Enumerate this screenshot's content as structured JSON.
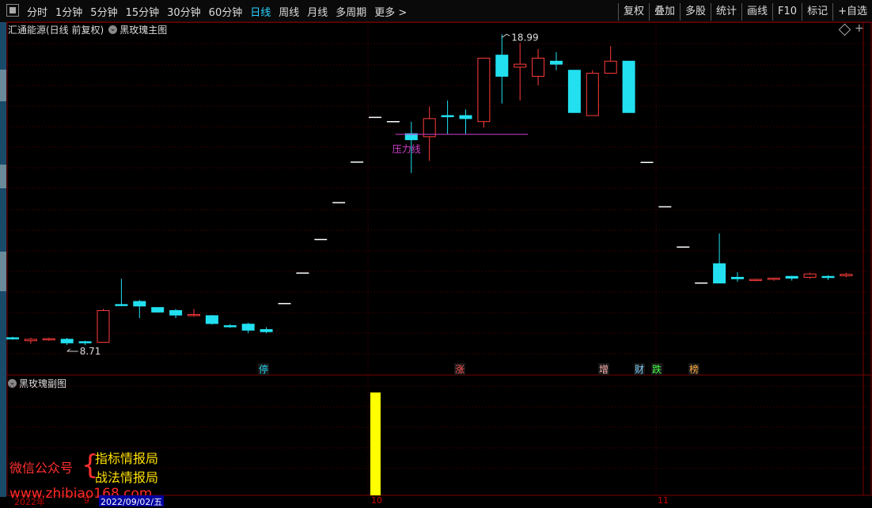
{
  "toolbar": {
    "left_items": [
      "分时",
      "1分钟",
      "5分钟",
      "15分钟",
      "30分钟",
      "60分钟",
      "日线",
      "周线",
      "月线",
      "多周期",
      "更多 >"
    ],
    "active": "日线",
    "right_items": [
      "复权",
      "叠加",
      "多股",
      "统计",
      "画线",
      "F10",
      "标记",
      "+自选"
    ]
  },
  "main_chart": {
    "stock_title": "汇通能源(日线 前复权)",
    "indicator_name": "黑玫瑰主图",
    "high_label": "18.99",
    "low_label": "8.71",
    "resistance_label": "压力线",
    "event_markers": [
      {
        "text": "停",
        "color": "#22d3ee"
      },
      {
        "text": "涨",
        "color": "#ff5555"
      },
      {
        "text": "增",
        "color": "#ffb0b0"
      },
      {
        "text": "财",
        "color": "#7fd0ff"
      },
      {
        "text": "跌",
        "color": "#44ff44"
      },
      {
        "text": "榜",
        "color": "#ffaa44"
      }
    ]
  },
  "sub_chart": {
    "indicator_name": "黑玫瑰副图"
  },
  "overlay": {
    "wechat_label": "微信公众号",
    "brand1": "指标情报局",
    "brand2": "战法情报局",
    "watermark": "www.zhibiao168.com"
  },
  "date_axis": {
    "labels": [
      "2022年",
      "9",
      "10",
      "11"
    ],
    "cursor_date": "2022/09/02/五"
  },
  "icons": [
    "window-icon",
    "chevron-circle-icon",
    "diamond-icon",
    "plus-icon"
  ],
  "chart_data": {
    "type": "candlestick",
    "title": "黑玫瑰主图",
    "ohlc": [
      [
        8.95,
        8.98,
        8.88,
        8.92
      ],
      [
        8.85,
        8.95,
        8.75,
        8.9
      ],
      [
        8.9,
        8.95,
        8.85,
        8.92
      ],
      [
        8.9,
        8.95,
        8.71,
        8.78
      ],
      [
        8.82,
        8.85,
        8.71,
        8.78
      ],
      [
        8.8,
        9.9,
        8.8,
        9.85
      ],
      [
        10.05,
        10.9,
        10.0,
        10.05
      ],
      [
        10.15,
        10.2,
        9.6,
        10.0
      ],
      [
        9.95,
        9.95,
        9.78,
        9.8
      ],
      [
        9.85,
        9.9,
        9.6,
        9.7
      ],
      [
        9.7,
        9.9,
        9.65,
        9.72
      ],
      [
        9.68,
        9.7,
        9.38,
        9.42
      ],
      [
        9.35,
        9.4,
        9.28,
        9.33
      ],
      [
        9.4,
        9.45,
        9.1,
        9.2
      ],
      [
        9.22,
        9.3,
        9.1,
        9.15
      ],
      [
        10.08,
        10.08,
        10.08,
        10.08
      ],
      [
        11.09,
        11.09,
        11.09,
        11.09
      ],
      [
        12.2,
        12.2,
        12.2,
        12.2
      ],
      [
        13.42,
        13.42,
        13.42,
        13.42
      ],
      [
        14.76,
        14.76,
        14.76,
        14.76
      ],
      [
        16.24,
        16.24,
        16.24,
        16.24
      ],
      [
        16.1,
        16.1,
        16.1,
        16.1
      ],
      [
        15.7,
        16.1,
        14.4,
        15.5
      ],
      [
        15.6,
        16.6,
        14.8,
        16.2
      ],
      [
        16.3,
        16.8,
        15.7,
        16.3
      ],
      [
        16.3,
        16.5,
        15.7,
        16.2
      ],
      [
        16.1,
        18.2,
        15.9,
        18.2
      ],
      [
        18.3,
        18.99,
        16.7,
        17.6
      ],
      [
        17.9,
        18.7,
        16.8,
        18.0
      ],
      [
        17.6,
        18.5,
        17.3,
        18.2
      ],
      [
        18.1,
        18.4,
        17.8,
        18.0
      ],
      [
        17.8,
        17.8,
        16.4,
        16.4
      ],
      [
        16.3,
        17.8,
        16.3,
        17.7
      ],
      [
        17.7,
        18.6,
        17.7,
        18.1
      ],
      [
        18.1,
        18.1,
        16.4,
        16.4
      ],
      [
        14.75,
        14.75,
        14.75,
        14.75
      ],
      [
        13.28,
        13.28,
        13.28,
        13.28
      ],
      [
        11.95,
        11.95,
        11.95,
        11.95
      ],
      [
        10.76,
        10.76,
        10.76,
        10.76
      ],
      [
        11.4,
        12.4,
        10.76,
        10.76
      ],
      [
        10.95,
        11.12,
        10.8,
        10.9
      ],
      [
        10.85,
        10.9,
        10.82,
        10.88
      ],
      [
        10.88,
        10.93,
        10.84,
        10.92
      ],
      [
        10.98,
        11.0,
        10.84,
        10.92
      ],
      [
        10.95,
        11.1,
        10.9,
        11.06
      ],
      [
        10.98,
        11.02,
        10.86,
        10.94
      ],
      [
        11.0,
        11.1,
        10.95,
        11.05
      ]
    ],
    "resistance_line": 15.68,
    "high": 18.99,
    "low": 8.71,
    "sub_bars": [
      {
        "index": 20,
        "color": "#ffff00",
        "value": 1
      }
    ]
  }
}
